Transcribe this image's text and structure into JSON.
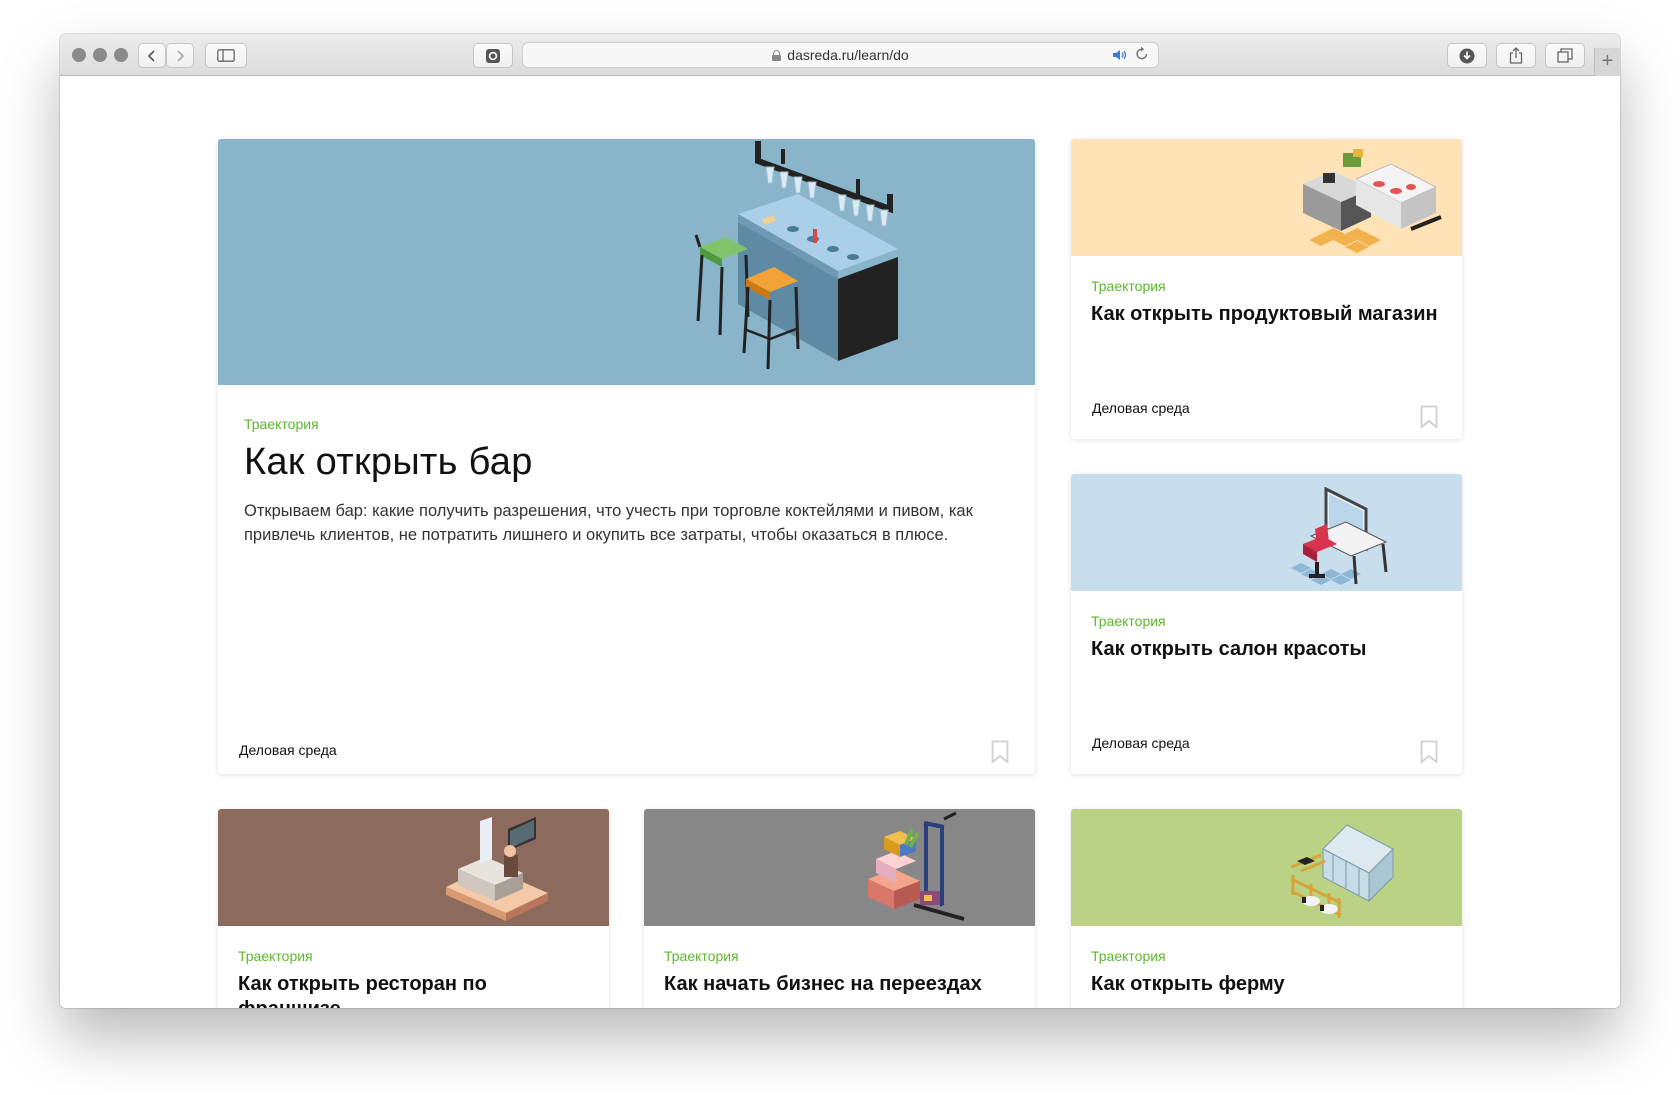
{
  "browser": {
    "url": "dasreda.ru/learn/do"
  },
  "cards": [
    {
      "tag": "Траектория",
      "title": "Как открыть бар",
      "description": "Открываем бар: какие получить разрешения, что учесть при торговле коктейлями и пивом, как привлечь клиентов, не потратить лишнего и окупить все затраты, чтобы оказаться в плюсе.",
      "source": "Деловая среда",
      "banner_color": "#8ab4ca",
      "illustration": "bar-counter-icon"
    },
    {
      "tag": "Траектория",
      "title": "Как открыть продуктовый магазин",
      "source": "Деловая среда",
      "banner_color": "#ffe2b6",
      "illustration": "grocery-counter-icon"
    },
    {
      "tag": "Траектория",
      "title": "Как открыть салон красоты",
      "source": "Деловая среда",
      "banner_color": "#c9deec",
      "illustration": "salon-chair-icon"
    },
    {
      "tag": "Траектория",
      "title": "Как открыть ресторан по франшизе",
      "banner_color": "#8c6a5e",
      "illustration": "restaurant-kiosk-icon"
    },
    {
      "tag": "Траектория",
      "title": "Как начать бизнес на переездах",
      "banner_color": "#878787",
      "illustration": "moving-cart-icon"
    },
    {
      "tag": "Траектория",
      "title": "Как открыть ферму",
      "banner_color": "#b9d283",
      "illustration": "greenhouse-farm-icon"
    }
  ]
}
